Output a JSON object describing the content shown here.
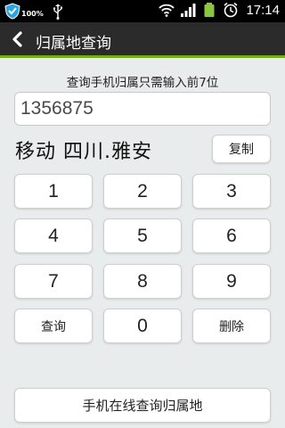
{
  "status_bar": {
    "battery_saver_percent": "100%",
    "time": "17:14",
    "icons": [
      "shield-icon",
      "usb-icon",
      "wifi-icon",
      "signal-icon",
      "battery-icon",
      "alarm-icon"
    ]
  },
  "title_bar": {
    "back_icon": "back-arrow-icon",
    "title": "归属地查询",
    "accent_color": "#74ad17"
  },
  "hint": "查询手机归属只需输入前7位",
  "input": {
    "value": "1356875"
  },
  "result": "移动 四川.雅安",
  "copy_label": "复制",
  "keypad": [
    [
      "1",
      "2",
      "3"
    ],
    [
      "4",
      "5",
      "6"
    ],
    [
      "7",
      "8",
      "9"
    ],
    [
      "查询",
      "0",
      "删除"
    ]
  ],
  "online_button_label": "手机在线查询归属地"
}
